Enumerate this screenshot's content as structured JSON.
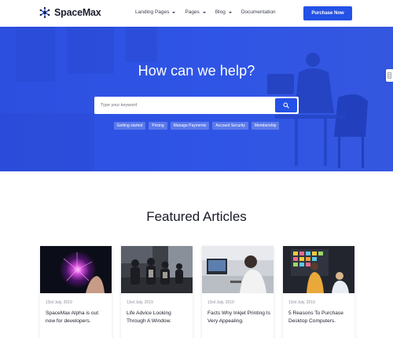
{
  "header": {
    "brand": "SpaceMax",
    "nav": [
      {
        "label": "Landing Pages",
        "dropdown": true
      },
      {
        "label": "Pages",
        "dropdown": true
      },
      {
        "label": "Blog",
        "dropdown": true
      },
      {
        "label": "Documentation",
        "dropdown": false
      }
    ],
    "cta_label": "Purchase Now"
  },
  "hero": {
    "title": "How can we help?",
    "search_placeholder": "Type your keyword",
    "chips": [
      "Getting started",
      "Pricing",
      "Manage Payments",
      "Account Security",
      "Membership"
    ],
    "side_tab_icon": "share-icon"
  },
  "featured": {
    "title": "Featured Articles",
    "articles": [
      {
        "date": "13rd July, 2019",
        "title": "SpaceMax Alpha is out now for developers.",
        "image": "plasma-ball-image"
      },
      {
        "date": "13rd July, 2019",
        "title": "Life Advice Looking Through A Window.",
        "image": "people-on-phones-image"
      },
      {
        "date": "13rd July, 2019",
        "title": "Facts Why Inkjet Printing Is Very Appealing.",
        "image": "office-desk-image"
      },
      {
        "date": "13rd July, 2019",
        "title": "5 Reasons To Purchase Desktop Computers.",
        "image": "presentation-image"
      }
    ]
  },
  "colors": {
    "primary": "#2451e6",
    "hero_bg": "#2f54e3",
    "text_dark": "#1b1f2b"
  }
}
